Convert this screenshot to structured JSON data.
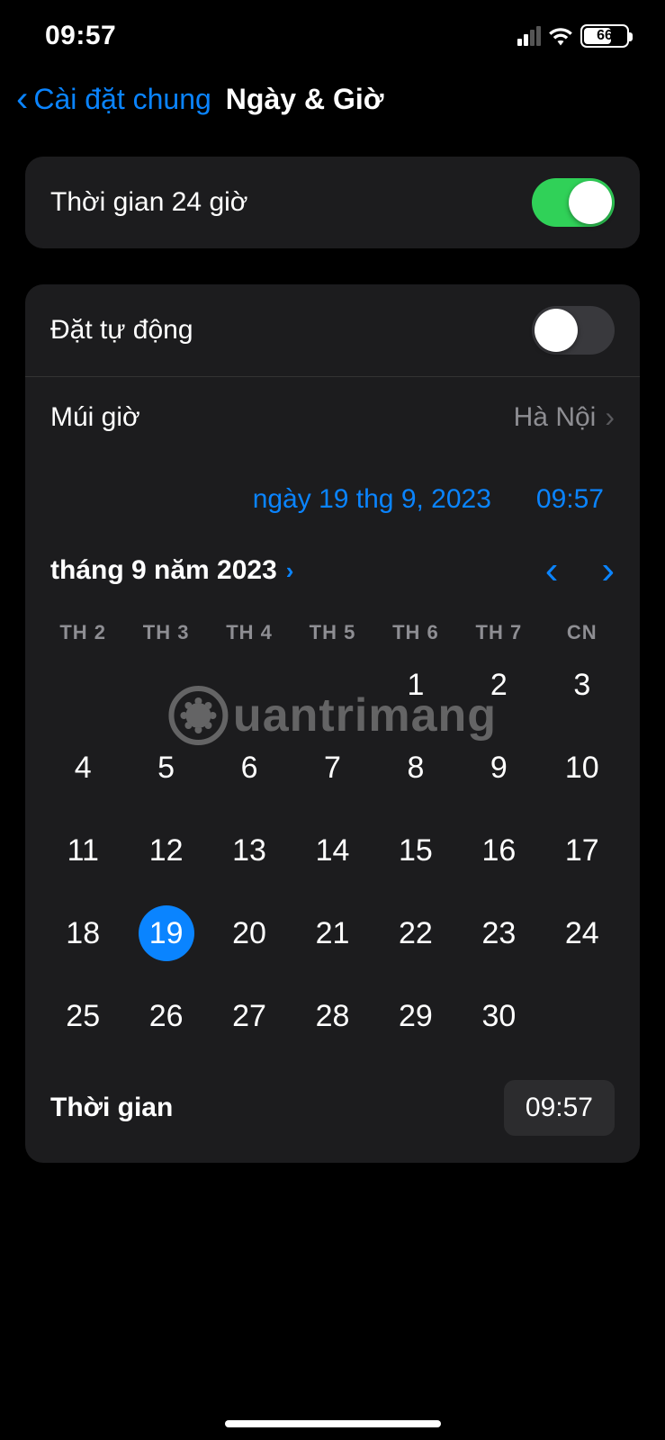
{
  "status_bar": {
    "time": "09:57",
    "battery_percent": "66"
  },
  "nav": {
    "back_label": "Cài đặt chung",
    "title": "Ngày & Giờ"
  },
  "settings": {
    "time_24h_label": "Thời gian 24 giờ",
    "auto_set_label": "Đặt tự động",
    "timezone_label": "Múi giờ",
    "timezone_value": "Hà Nội",
    "date_display": "ngày 19 thg 9, 2023",
    "time_display": "09:57",
    "time_row_label": "Thời gian",
    "time_row_value": "09:57"
  },
  "calendar": {
    "month_label": "tháng 9 năm 2023",
    "weekdays": [
      "TH 2",
      "TH 3",
      "TH 4",
      "TH 5",
      "TH 6",
      "TH 7",
      "CN"
    ],
    "leading_blanks": 4,
    "days_in_month": 30,
    "selected_day": 19
  },
  "watermark": {
    "text": "uantrimang"
  }
}
